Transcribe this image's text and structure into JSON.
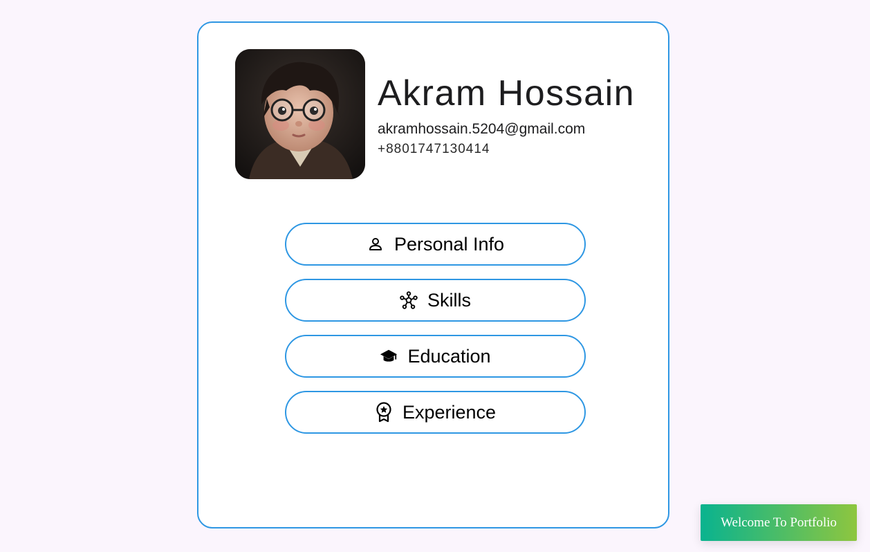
{
  "profile": {
    "name": "Akram Hossain",
    "email": "akramhossain.5204@gmail.com",
    "phone": "+8801747130414"
  },
  "menu": {
    "items": [
      {
        "label": "Personal Info",
        "icon": "person-icon"
      },
      {
        "label": "Skills",
        "icon": "network-icon"
      },
      {
        "label": "Education",
        "icon": "graduation-cap-icon"
      },
      {
        "label": "Experience",
        "icon": "award-badge-icon"
      }
    ]
  },
  "toast": {
    "message": "Welcome To Portfolio"
  },
  "colors": {
    "accent_border": "#2e97e3",
    "page_background": "#fbf5fd",
    "toast_gradient_start": "#09b38f",
    "toast_gradient_end": "#8ec63f"
  }
}
